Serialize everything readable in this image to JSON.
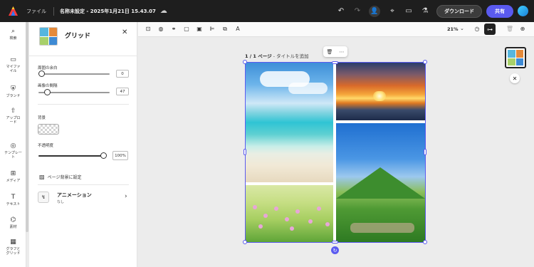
{
  "topbar": {
    "file_menu": "ファイル",
    "doc_title": "名称未設定 - 2025年1月21日 15.43.07",
    "download_label": "ダウンロード",
    "share_label": "共有"
  },
  "rail": {
    "items": [
      {
        "label": "検索",
        "icon": "search-icon"
      },
      {
        "label": "マイファイル",
        "icon": "folder-icon"
      },
      {
        "label": "ブランド",
        "icon": "brand-icon"
      },
      {
        "label": "アップロード",
        "icon": "upload-icon"
      },
      {
        "label": "テンプレート",
        "icon": "template-icon"
      },
      {
        "label": "メディア",
        "icon": "media-icon"
      },
      {
        "label": "テキスト",
        "icon": "text-icon"
      },
      {
        "label": "素材",
        "icon": "elements-icon"
      },
      {
        "label": "グラフとグリッド",
        "icon": "grid-icon"
      }
    ]
  },
  "panel": {
    "title": "グリッド",
    "outer_margin_label": "周囲の余白",
    "outer_margin_value": "0",
    "outer_margin_fraction": 0.0,
    "spacing_label": "画像の間隔",
    "spacing_value": "47",
    "background_label": "背景",
    "opacity_label": "不透明度",
    "opacity_value": "100%",
    "set_bg_label": "ページ背景に設定",
    "animation_title": "アニメーション",
    "animation_sub": "なし"
  },
  "toolbar": {
    "zoom": "21%"
  },
  "canvas": {
    "page_prefix": "1 / 1 ページ",
    "page_suffix": " - タイトルを追加"
  },
  "colors": {
    "accent": "#5b5bf0",
    "topbar": "#1e1e1e"
  }
}
